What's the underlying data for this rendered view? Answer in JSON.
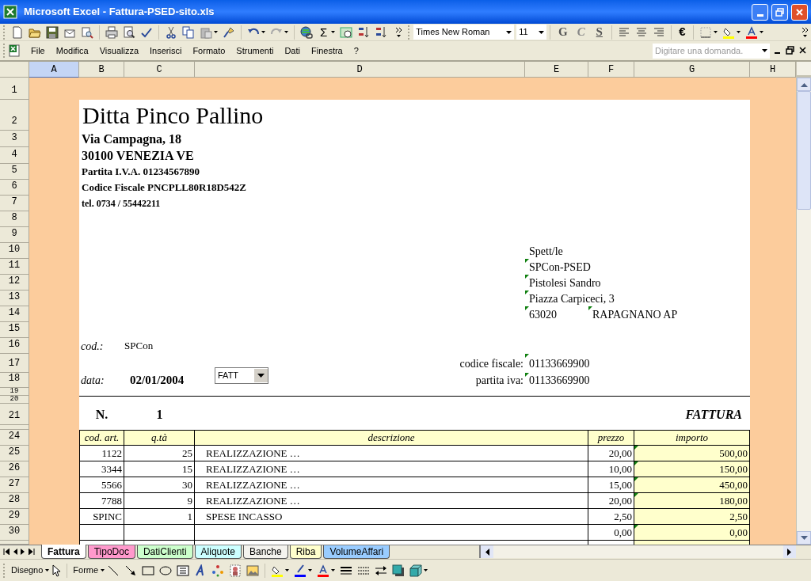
{
  "window": {
    "title": "Microsoft Excel - Fattura-PSED-sito.xls"
  },
  "formatting": {
    "font": "Times New Roman",
    "size": "11",
    "sum": "Σ",
    "style_buttons": [
      "G",
      "C",
      "S"
    ],
    "euro": "€"
  },
  "menu": [
    "File",
    "Modifica",
    "Visualizza",
    "Inserisci",
    "Formato",
    "Strumenti",
    "Dati",
    "Finestra",
    "?"
  ],
  "help_search": {
    "placeholder": "Digitare una domanda."
  },
  "columns": [
    {
      "label": "A",
      "selected": true
    },
    {
      "label": "B",
      "selected": false
    },
    {
      "label": "C",
      "selected": false
    },
    {
      "label": "D",
      "selected": false
    },
    {
      "label": "E",
      "selected": false
    },
    {
      "label": "F",
      "selected": false
    },
    {
      "label": "G",
      "selected": false
    },
    {
      "label": "H",
      "selected": false
    }
  ],
  "row_numbers": [
    "1",
    "2",
    "3",
    "4",
    "5",
    "6",
    "7",
    "8",
    "9",
    "10",
    "11",
    "12",
    "13",
    "14",
    "15",
    "16",
    "17",
    "18",
    "19",
    "20",
    "21",
    "24",
    "25",
    "26",
    "27",
    "28",
    "29",
    "30"
  ],
  "invoice": {
    "company": "Ditta Pinco Pallino",
    "company_details": [
      "Via Campagna, 18",
      "30100 VENEZIA VE",
      "Partita I.V.A. 01234567890",
      "Codice Fiscale PNCPLL80R18D542Z",
      "tel. 0734 / 55442211"
    ],
    "recipient": [
      {
        "text": "Spett/le",
        "flagged": false
      },
      {
        "text": "SPCon-PSED",
        "flagged": true
      },
      {
        "text": "Pistolesi Sandro",
        "flagged": true
      },
      {
        "text": "Piazza Carpiceci, 3",
        "flagged": true
      },
      {
        "text": "63020",
        "flagged": true
      }
    ],
    "recipient_city": {
      "text": "RAPAGNANO AP",
      "flagged": true
    },
    "code_label": "cod.:",
    "code": "SPCon",
    "fiscal_code_label": "codice fiscale:",
    "fiscal_code": {
      "text": "01133669900",
      "flagged": true
    },
    "date_label": "data:",
    "date": "02/01/2004",
    "doc_type": "FATT",
    "vat_label": "partita iva:",
    "vat": {
      "text": "01133669900",
      "flagged": true
    },
    "number_label": "N.",
    "number": "1",
    "doc_title": "FATTURA",
    "table": {
      "columns": [
        "cod. art.",
        "q.tà",
        "descrizione",
        "prezzo",
        "importo"
      ],
      "rows": [
        {
          "code": "1122",
          "qty": "25",
          "description": "REALIZZAZIONE …",
          "price": "20,00",
          "amount": "500,00",
          "flagged": true
        },
        {
          "code": "3344",
          "qty": "15",
          "description": "REALIZZAZIONE …",
          "price": "10,00",
          "amount": "150,00",
          "flagged": true
        },
        {
          "code": "5566",
          "qty": "30",
          "description": "REALIZZAZIONE …",
          "price": "15,00",
          "amount": "450,00",
          "flagged": true
        },
        {
          "code": "7788",
          "qty": "9",
          "description": "REALIZZAZIONE …",
          "price": "20,00",
          "amount": "180,00",
          "flagged": true
        },
        {
          "code": "SPINC",
          "qty": "1",
          "description": "SPESE INCASSO",
          "price": "2,50",
          "amount": "2,50",
          "flagged": false
        },
        {
          "price": "0,00",
          "amount": "0,00",
          "flagged": true
        }
      ]
    }
  },
  "sheet_tabs": [
    {
      "label": "Fattura",
      "selected": true,
      "color": "#ffffff"
    },
    {
      "label": "TipoDoc",
      "selected": false,
      "color": "#ff99cc"
    },
    {
      "label": "DatiClienti",
      "selected": false,
      "color": "#ccffcc"
    },
    {
      "label": "Aliquote",
      "selected": false,
      "color": "#ccffff"
    },
    {
      "label": "Banche",
      "selected": false,
      "color": "#f4f3ee"
    },
    {
      "label": "Riba",
      "selected": false,
      "color": "#ffffcc"
    },
    {
      "label": "VolumeAffari",
      "selected": false,
      "color": "#99ccff"
    }
  ],
  "drawing_toolbar": {
    "draw_menu": "Disegno",
    "shapes_menu": "Forme"
  }
}
